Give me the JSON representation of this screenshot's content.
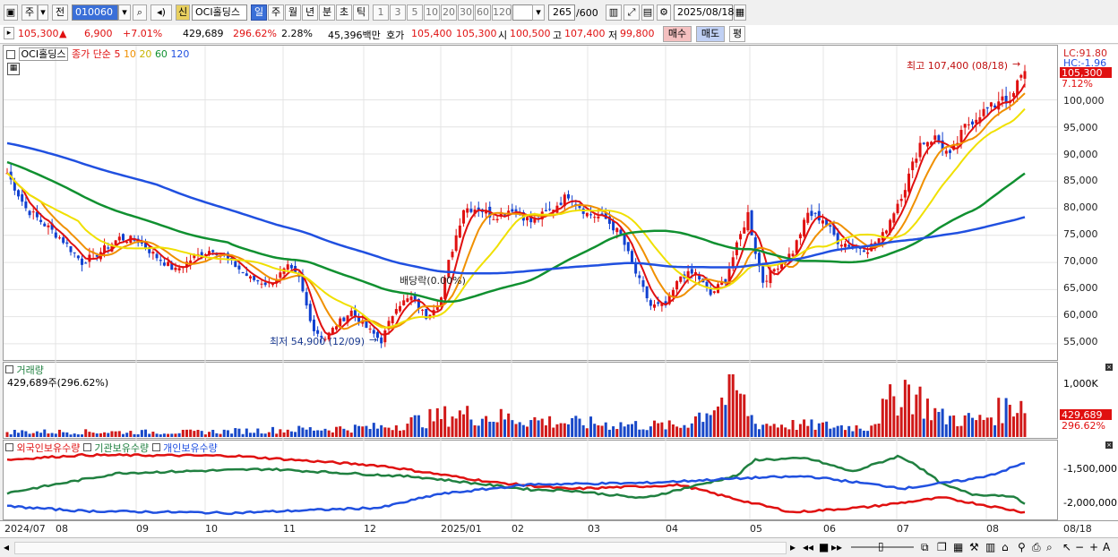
{
  "toolbar": {
    "market": "주",
    "prev": "전",
    "code": "010060",
    "credit": "신",
    "stock_name": "OCI홀딩스",
    "periods": [
      "일",
      "주",
      "월",
      "년",
      "분",
      "초",
      "틱"
    ],
    "intervals": [
      "1",
      "3",
      "5",
      "10",
      "20",
      "30",
      "60",
      "120"
    ],
    "count": "265",
    "count_total": "/600",
    "date": "2025/08/18"
  },
  "info": {
    "price": "105,300",
    "change": "6,900",
    "change_pct": "+7.01%",
    "volume": "429,689",
    "volume_ratio": "296.62%",
    "turnover": "2.28%",
    "amount": "45,396백만",
    "quote_label": "호가",
    "ask": "105,400",
    "bid": "105,300",
    "open_label": "시",
    "open": "100,500",
    "high_label": "고",
    "high": "107,400",
    "low_label": "저",
    "low": "99,800",
    "buy": "매수",
    "sell": "매도",
    "flat": "평"
  },
  "price_panel": {
    "name": "OCI홀딩스",
    "indicator": "종가 단순",
    "ma_periods": [
      "5",
      "10",
      "20",
      "60",
      "120"
    ],
    "ma_colors": [
      "#e01010",
      "#f09000",
      "#f0e000",
      "#109030",
      "#2050e0"
    ],
    "lc": "LC:91.80",
    "hc": "HC:-1.96",
    "price_tag": "105,300",
    "pct_tag": "7.12%",
    "high_note": "최고 107,400 (08/18)",
    "low_note": "최저 54,900 (12/09)",
    "dividend_note": "배당락(0.00%)",
    "yticks": [
      "100,000",
      "95,000",
      "90,000",
      "85,000",
      "80,000",
      "75,000",
      "70,000",
      "65,000",
      "60,000",
      "55,000"
    ]
  },
  "volume_panel": {
    "title": "거래량",
    "value": "429,689주(296.62%)",
    "tick": "1,000K",
    "tag": "429,689",
    "tag_pct": "296.62%"
  },
  "holding_panel": {
    "series": [
      "외국인보유수량",
      "기관보유수량",
      "개인보유수량"
    ],
    "colors": [
      "#e01010",
      "#208040",
      "#2050e0"
    ],
    "yticks": [
      "-1,500,000",
      "-2,000,000"
    ]
  },
  "xaxis": [
    "2024/07",
    "08",
    "09",
    "10",
    "11",
    "12",
    "2025/01",
    "02",
    "03",
    "04",
    "05",
    "06",
    "07",
    "08",
    "08/18"
  ],
  "chart_data": {
    "type": "candlestick",
    "title": "OCI홀딩스",
    "ylim": [
      52000,
      110000
    ],
    "price_path": [
      [
        0,
        86500
      ],
      [
        5,
        80000
      ],
      [
        10,
        77000
      ],
      [
        15,
        74000
      ],
      [
        20,
        70000
      ],
      [
        25,
        72000
      ],
      [
        30,
        74500
      ],
      [
        35,
        74000
      ],
      [
        40,
        71000
      ],
      [
        45,
        68500
      ],
      [
        50,
        71000
      ],
      [
        55,
        72500
      ],
      [
        60,
        70000
      ],
      [
        65,
        67000
      ],
      [
        70,
        66000
      ],
      [
        75,
        69000
      ],
      [
        78,
        67000
      ],
      [
        80,
        62000
      ],
      [
        82,
        57500
      ],
      [
        85,
        56000
      ],
      [
        88,
        58500
      ],
      [
        92,
        61000
      ],
      [
        96,
        58000
      ],
      [
        100,
        55500
      ],
      [
        104,
        62000
      ],
      [
        108,
        63500
      ],
      [
        112,
        60000
      ],
      [
        116,
        63500
      ],
      [
        118,
        70000
      ],
      [
        122,
        80000
      ],
      [
        126,
        80000
      ],
      [
        130,
        78500
      ],
      [
        135,
        80000
      ],
      [
        140,
        77500
      ],
      [
        145,
        79500
      ],
      [
        150,
        82500
      ],
      [
        155,
        79000
      ],
      [
        160,
        78000
      ],
      [
        164,
        75000
      ],
      [
        168,
        68000
      ],
      [
        172,
        62000
      ],
      [
        176,
        62000
      ],
      [
        180,
        67500
      ],
      [
        184,
        68000
      ],
      [
        188,
        64000
      ],
      [
        192,
        67000
      ],
      [
        196,
        75000
      ],
      [
        198,
        79000
      ],
      [
        200,
        72000
      ],
      [
        202,
        66500
      ],
      [
        206,
        69500
      ],
      [
        210,
        72000
      ],
      [
        214,
        79000
      ],
      [
        218,
        78000
      ],
      [
        222,
        74000
      ],
      [
        226,
        73000
      ],
      [
        230,
        72500
      ],
      [
        234,
        75000
      ],
      [
        236,
        78000
      ],
      [
        240,
        84000
      ],
      [
        244,
        92000
      ],
      [
        248,
        93000
      ],
      [
        252,
        89500
      ],
      [
        256,
        95000
      ],
      [
        260,
        97500
      ],
      [
        264,
        99000
      ],
      [
        266,
        101000
      ],
      [
        268,
        99000
      ],
      [
        270,
        103000
      ],
      [
        272,
        105300
      ]
    ],
    "volume_path": [
      [
        0,
        60
      ],
      [
        50,
        55
      ],
      [
        100,
        110
      ],
      [
        120,
        260
      ],
      [
        150,
        160
      ],
      [
        180,
        120
      ],
      [
        195,
        520
      ],
      [
        200,
        150
      ],
      [
        230,
        110
      ],
      [
        240,
        580
      ],
      [
        246,
        350
      ],
      [
        250,
        220
      ],
      [
        260,
        190
      ],
      [
        272,
        430
      ]
    ],
    "holding_foreign": [
      [
        0,
        -1380000
      ],
      [
        20,
        -1310000
      ],
      [
        60,
        -1320000
      ],
      [
        100,
        -1470000
      ],
      [
        130,
        -1720000
      ],
      [
        150,
        -1820000
      ],
      [
        180,
        -1760000
      ],
      [
        196,
        -1990000
      ],
      [
        210,
        -2170000
      ],
      [
        230,
        -2090000
      ],
      [
        250,
        -1950000
      ],
      [
        260,
        -2050000
      ],
      [
        272,
        -2170000
      ]
    ],
    "holding_institution": [
      [
        0,
        -1880000
      ],
      [
        30,
        -1580000
      ],
      [
        70,
        -1520000
      ],
      [
        110,
        -1640000
      ],
      [
        140,
        -1830000
      ],
      [
        150,
        -1840000
      ],
      [
        170,
        -1960000
      ],
      [
        195,
        -1620000
      ],
      [
        200,
        -1380000
      ],
      [
        214,
        -1360000
      ],
      [
        226,
        -1560000
      ],
      [
        238,
        -1330000
      ],
      [
        242,
        -1420000
      ],
      [
        250,
        -1750000
      ],
      [
        258,
        -1900000
      ],
      [
        268,
        -1920000
      ],
      [
        272,
        -2030000
      ]
    ],
    "holding_individual": [
      [
        0,
        -2080000
      ],
      [
        20,
        -2150000
      ],
      [
        60,
        -2180000
      ],
      [
        100,
        -2100000
      ],
      [
        115,
        -1900000
      ],
      [
        140,
        -1750000
      ],
      [
        170,
        -1730000
      ],
      [
        200,
        -1650000
      ],
      [
        214,
        -1630000
      ],
      [
        240,
        -1810000
      ],
      [
        258,
        -1670000
      ],
      [
        264,
        -1590000
      ],
      [
        272,
        -1430000
      ]
    ]
  }
}
